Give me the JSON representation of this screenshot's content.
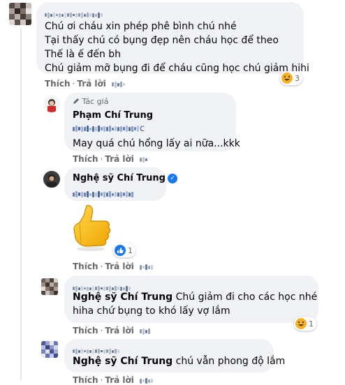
{
  "comments": [
    {
      "lines": [
        "Chú ơi cháu xin phép phê bình chú nhé",
        "Tại thấy chú có bụng đẹp nên cháu học để theo",
        "Thế là ế đến bh",
        "Chú giảm mỡ bụng đi để cháu cũng học chú giảm hihi"
      ],
      "like": "Thích",
      "reply": "Trả lời",
      "reaction_count": "3"
    },
    {
      "author_tag": "Tác giả",
      "author": "Phạm Chí Trung",
      "mention_suffix": "c",
      "text": "May quá chú hổng lấy ai nữa...kkk",
      "like": "Thích",
      "reply": "Trả lời"
    },
    {
      "author": "Nghệ sỹ Chí Trung",
      "like": "Thích",
      "reply": "Trả lời",
      "reaction_count": "1"
    },
    {
      "mention": "Nghệ sỹ Chí Trung",
      "text_1": "Chú giảm đi cho các học nhé",
      "text_2": "hiha chứ bụng to khó lấy vợ lắm",
      "like": "Thích",
      "reply": "Trả lời",
      "reaction_count": "1"
    },
    {
      "mention": "Nghệ sỹ Chí Trung",
      "text": "chú vẫn phong độ lắm",
      "like": "Thích",
      "reply": "Trả lời"
    }
  ],
  "icons": {
    "verified": "verified-badge-icon",
    "thumbs_up_sticker": "thumbs-up-sticker",
    "like_reaction": "like-reaction-icon",
    "haha_reaction": "haha-reaction-icon",
    "author_pen": "pen-icon"
  },
  "colors": {
    "bubble": "#f0f2f5",
    "meta": "#65676b",
    "verified": "#1877f2",
    "haha": "#f7b125"
  }
}
